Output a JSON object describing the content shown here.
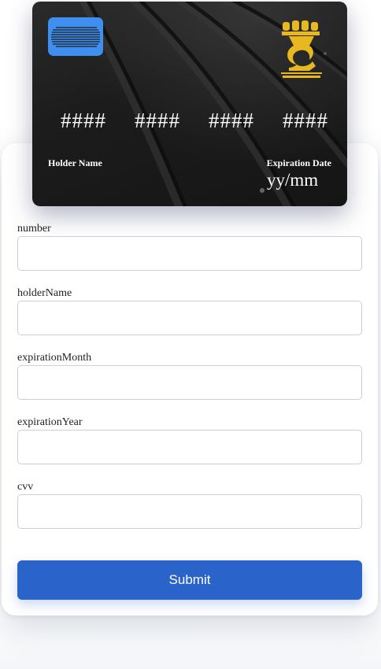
{
  "card": {
    "number_groups": [
      "####",
      "####",
      "####",
      "####"
    ],
    "holder_label": "Holder Name",
    "expiration_label": "Expiration Date",
    "expiration_value": "yy/mm",
    "chip_color": "#3f8ff0",
    "logo_color": "#e8b820"
  },
  "form": {
    "fields": [
      {
        "label": "number",
        "value": ""
      },
      {
        "label": "holderName",
        "value": ""
      },
      {
        "label": "expirationMonth",
        "value": ""
      },
      {
        "label": "expirationYear",
        "value": ""
      },
      {
        "label": "cvv",
        "value": ""
      }
    ],
    "submit_label": "Submit",
    "accent_color": "#2a63c9"
  }
}
